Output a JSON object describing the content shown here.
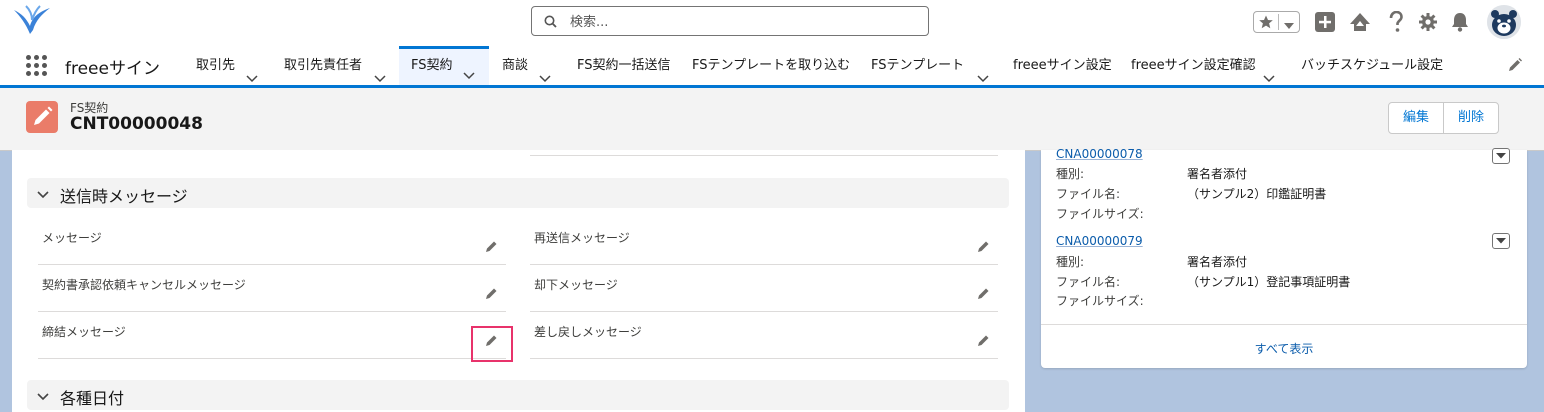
{
  "header": {
    "search_placeholder": "検索...",
    "icons": [
      "star-icon",
      "chevron-down-icon",
      "plus-icon",
      "trailhead-icon",
      "help-icon",
      "gear-icon",
      "bell-icon",
      "avatar"
    ]
  },
  "nav": {
    "app_name": "freeeサイン",
    "tabs": [
      {
        "label": "取引先",
        "has_menu": true
      },
      {
        "label": "取引先責任者",
        "has_menu": true
      },
      {
        "label": "FS契約",
        "has_menu": true,
        "active": true
      },
      {
        "label": "商談",
        "has_menu": true
      },
      {
        "label": "FS契約一括送信",
        "has_menu": false
      },
      {
        "label": "FSテンプレートを取り込む",
        "has_menu": false
      },
      {
        "label": "FSテンプレート",
        "has_menu": true
      },
      {
        "label": "freeeサイン設定",
        "has_menu": false
      },
      {
        "label": "freeeサイン設定確認",
        "has_menu": true
      },
      {
        "label": "バッチスケジュール設定",
        "has_menu": false
      }
    ]
  },
  "record": {
    "object_label": "FS契約",
    "name": "CNT00000048",
    "actions": {
      "edit": "編集",
      "delete": "削除"
    }
  },
  "main": {
    "sections": [
      {
        "title": "送信時メッセージ",
        "fields": [
          {
            "label": "メッセージ",
            "value": ""
          },
          {
            "label": "再送信メッセージ",
            "value": ""
          },
          {
            "label": "契約書承認依頼キャンセルメッセージ",
            "value": ""
          },
          {
            "label": "却下メッセージ",
            "value": ""
          },
          {
            "label": "締結メッセージ",
            "value": ""
          },
          {
            "label": "差し戻しメッセージ",
            "value": ""
          }
        ]
      },
      {
        "title": "各種日付"
      }
    ]
  },
  "related": {
    "items": [
      {
        "id": "CNA00000078",
        "rows": [
          {
            "label": "種別:",
            "value": "署名者添付"
          },
          {
            "label": "ファイル名:",
            "value": "（サンプル2）印鑑証明書"
          },
          {
            "label": "ファイルサイズ:",
            "value": ""
          }
        ]
      },
      {
        "id": "CNA00000079",
        "rows": [
          {
            "label": "種別:",
            "value": "署名者添付"
          },
          {
            "label": "ファイル名:",
            "value": "（サンプル1）登記事項証明書"
          },
          {
            "label": "ファイルサイズ:",
            "value": ""
          }
        ]
      }
    ],
    "show_all": "すべて表示"
  },
  "colors": {
    "brand": "#0176d3",
    "record_icon": "#ea7c69",
    "highlight": "#e8326b",
    "background": "#b0c4df"
  }
}
